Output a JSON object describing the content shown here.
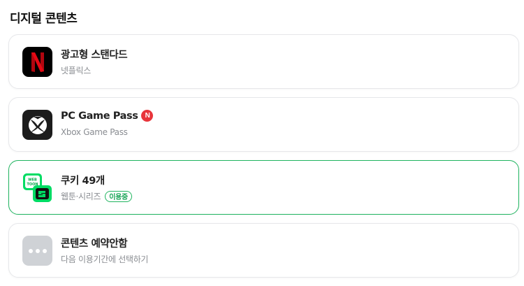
{
  "section": {
    "title": "디지털 콘텐츠"
  },
  "items": [
    {
      "title": "광고형 스탠다드",
      "subtitle": "넷플릭스",
      "icon": "netflix-logo-icon",
      "active": false
    },
    {
      "title": "PC Game Pass",
      "badge": "N",
      "subtitle": "Xbox Game Pass",
      "icon": "xbox-logo-icon",
      "active": false
    },
    {
      "title": "쿠키 49개",
      "subtitle": "웹툰·시리즈",
      "status_badge": "이용중",
      "icon": "webtoon-series-logo-icon",
      "icon_text": "WEB TOON",
      "active": true
    },
    {
      "title": "콘텐츠 예약안함",
      "subtitle": "다음 이용기간에 선택하기",
      "icon": "more-dots-icon",
      "active": false
    }
  ],
  "colors": {
    "accent_green": "#1fb45f",
    "badge_red": "#e8353b",
    "netflix_red": "#e50914",
    "subtitle_gray": "#8a8d92"
  }
}
